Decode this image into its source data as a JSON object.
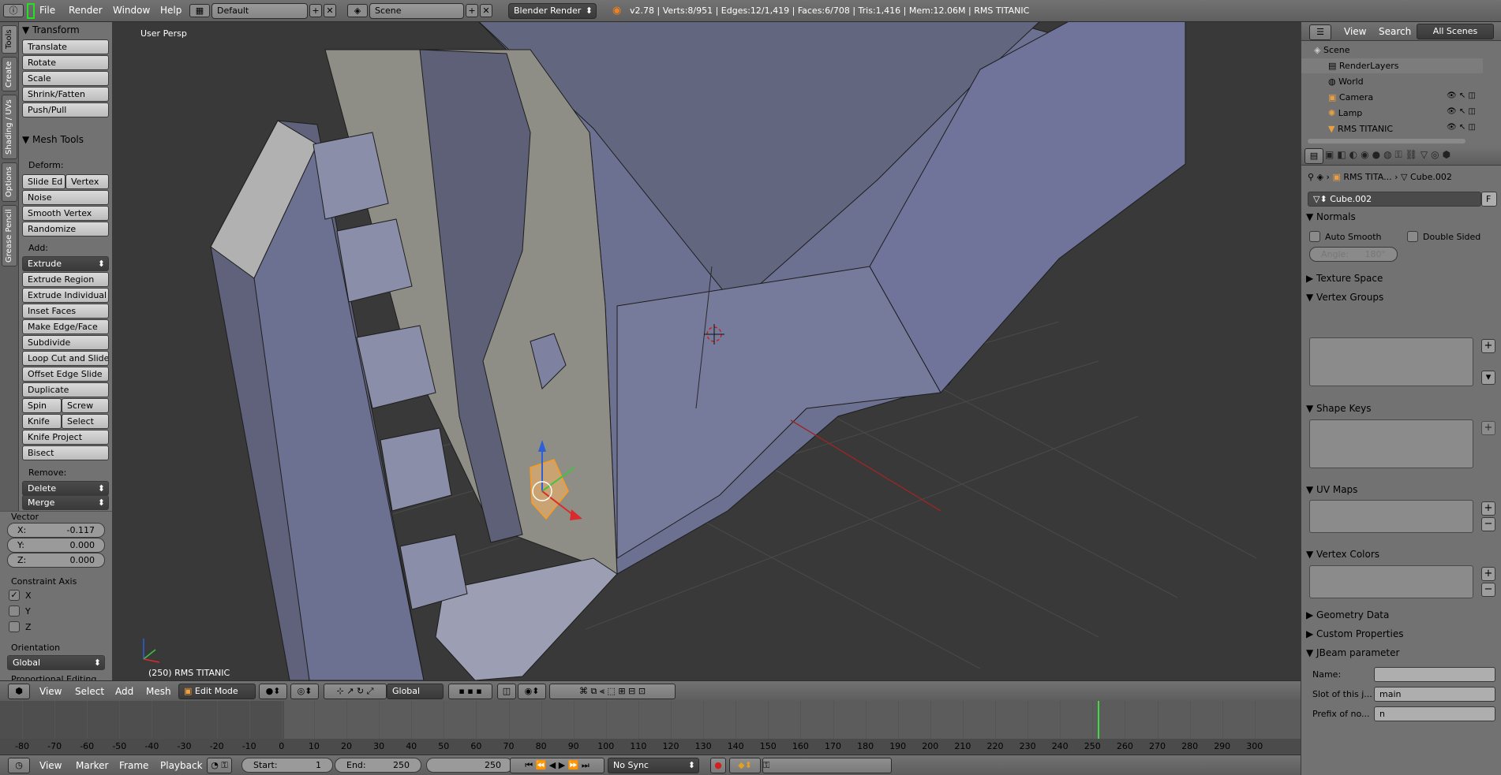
{
  "topbar": {
    "menus": [
      "File",
      "Render",
      "Window",
      "Help"
    ],
    "layout": "Default",
    "scene": "Scene",
    "engine": "Blender Render",
    "stats": "v2.78 | Verts:8/951 | Edges:12/1,419 | Faces:6/708 | Tris:1,416 | Mem:12.06M | RMS TITANIC"
  },
  "toolshelf": {
    "tabs": [
      "Tools",
      "Create",
      "Shading / UVs",
      "Options",
      "Grease Pencil"
    ],
    "transform_title": "Transform",
    "transform": [
      "Translate",
      "Rotate",
      "Scale",
      "Shrink/Fatten",
      "Push/Pull"
    ],
    "mesh_tools_title": "Mesh Tools",
    "deform_label": "Deform:",
    "deform": [
      "Slide Ed",
      "Vertex",
      "Noise",
      "Smooth Vertex",
      "Randomize"
    ],
    "add_label": "Add:",
    "add": [
      "Extrude",
      "Extrude Region",
      "Extrude Individual",
      "Inset Faces",
      "Make Edge/Face",
      "Subdivide",
      "Loop Cut and Slide",
      "Offset Edge Slide",
      "Duplicate",
      "Spin",
      "Screw",
      "Knife",
      "Select",
      "Knife Project",
      "Bisect"
    ],
    "remove_label": "Remove:",
    "remove": [
      "Delete",
      "Merge"
    ]
  },
  "operator": {
    "vector_label": "Vector",
    "x_label": "X:",
    "x": "-0.117",
    "y_label": "Y:",
    "y": "0.000",
    "z_label": "Z:",
    "z": "0.000",
    "constraint_label": "Constraint Axis",
    "axes": [
      "X",
      "Y",
      "Z"
    ],
    "orientation_label": "Orientation",
    "orientation": "Global",
    "proportional_label": "Proportional Editing"
  },
  "viewport": {
    "view_name": "User Persp",
    "object_label": "(250) RMS TITANIC"
  },
  "header3d": {
    "menus": [
      "View",
      "Select",
      "Add",
      "Mesh"
    ],
    "mode": "Edit Mode",
    "orientation": "Global"
  },
  "timeline": {
    "ticks": [
      "-80",
      "-70",
      "-60",
      "-50",
      "-40",
      "-30",
      "-20",
      "-10",
      "0",
      "10",
      "20",
      "30",
      "40",
      "50",
      "60",
      "70",
      "80",
      "90",
      "100",
      "110",
      "120",
      "130",
      "140",
      "150",
      "160",
      "170",
      "180",
      "190",
      "200",
      "210",
      "220",
      "230",
      "240",
      "250",
      "260",
      "270",
      "280",
      "290",
      "300"
    ],
    "current_frame": 250,
    "menus": [
      "View",
      "Marker",
      "Frame",
      "Playback"
    ],
    "start_label": "Start:",
    "start": "1",
    "end_label": "End:",
    "end": "250",
    "frame": "250",
    "sync": "No Sync"
  },
  "outliner": {
    "menus": [
      "View",
      "Search"
    ],
    "filter": "All Scenes",
    "items": [
      "Scene",
      "RenderLayers",
      "World",
      "Camera",
      "Lamp",
      "RMS TITANIC"
    ]
  },
  "properties": {
    "breadcrumb_obj": "RMS TITA...",
    "breadcrumb_data": "Cube.002",
    "mesh_name": "Cube.002",
    "fake_user": "F",
    "normals": "Normals",
    "auto_smooth": "Auto Smooth",
    "double_sided": "Double Sided",
    "angle": "Angle:",
    "angle_value": "180°",
    "texture_space": "Texture Space",
    "vertex_groups": "Vertex Groups",
    "shape_keys": "Shape Keys",
    "uv_maps": "UV Maps",
    "vertex_colors": "Vertex Colors",
    "geometry_data": "Geometry Data",
    "custom_properties": "Custom Properties",
    "jbeam": "JBeam parameter",
    "name_label": "Name:",
    "name_value": "",
    "slot_label": "Slot of this j...",
    "slot_value": "main",
    "prefix_label": "Prefix of no...",
    "prefix_value": "n"
  },
  "colors": {
    "accent": "#5680c2",
    "selection": "#ffa030",
    "timeline_cursor": "#3ddc3d",
    "mesh": "#6d7191"
  }
}
